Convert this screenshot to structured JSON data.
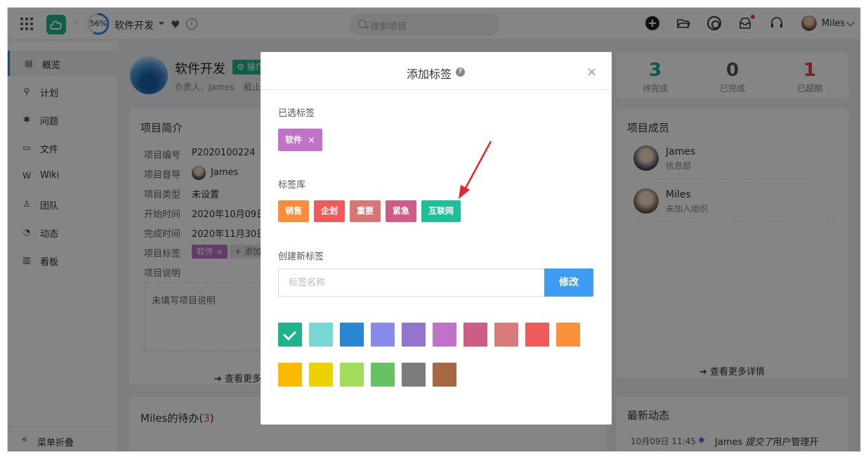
{
  "topbar": {
    "progress": "56%",
    "progress_value": 0.56,
    "project_name": "软件开发",
    "search_placeholder": "搜索项目",
    "user_name": "Miles"
  },
  "sidebar": {
    "items": [
      {
        "label": "概览",
        "icon": "overview-icon",
        "active": true
      },
      {
        "label": "计划",
        "icon": "plan-icon"
      },
      {
        "label": "问题",
        "icon": "bug-icon"
      },
      {
        "label": "文件",
        "icon": "folder-icon"
      },
      {
        "label": "Wiki",
        "icon": "wiki-icon"
      },
      {
        "label": "团队",
        "icon": "team-icon"
      },
      {
        "label": "动态",
        "icon": "activity-icon"
      },
      {
        "label": "看板",
        "icon": "board-icon"
      }
    ],
    "collapse_label": "菜单折叠"
  },
  "project": {
    "name": "软件开发",
    "op_label": "操作",
    "owner_line": "负责人：James",
    "owner_suffix": "截止",
    "intro_title": "项目简介",
    "fields": [
      {
        "label": "项目编号",
        "value": "P2020100224"
      },
      {
        "label": "项目督导",
        "value": "James"
      },
      {
        "label": "项目类型",
        "value": "未设置"
      },
      {
        "label": "开始时间",
        "value": "2020年10月09日"
      },
      {
        "label": "完成时间",
        "value": "2020年11月30日"
      },
      {
        "label": "项目标签",
        "value": ""
      },
      {
        "label": "项目说明",
        "value": ""
      }
    ],
    "tag_chip": "软件",
    "tag_add": "+ 添加",
    "description_placeholder": "未填写项目说明",
    "see_more": "查看更多"
  },
  "stats": [
    {
      "value": "3",
      "label": "待完成",
      "color": "#1fa68a"
    },
    {
      "value": "0",
      "label": "已完成",
      "color": "#555555"
    },
    {
      "value": "1",
      "label": "已超期",
      "color": "#e0433f"
    }
  ],
  "members": {
    "title": "项目成员",
    "list": [
      {
        "name": "James",
        "dept": "信息部"
      },
      {
        "name": "Miles",
        "dept": "未加入组织"
      }
    ],
    "see_more": "查看更多详情"
  },
  "todo": {
    "title_prefix": "Miles的待办(",
    "count": "3",
    "title_suffix": ")"
  },
  "activity": {
    "title": "最新动态",
    "entry_time": "10月09日 11:45",
    "entry_user": "James",
    "entry_action": "提交了",
    "entry_text": "用户管理开"
  },
  "modal": {
    "title": "添加标签",
    "selected_label": "已选标签",
    "selected_tags": [
      {
        "name": "软件",
        "color": "#c073c8"
      }
    ],
    "library_label": "标签库",
    "library_tags": [
      {
        "name": "销售",
        "color": "#fb8c3c"
      },
      {
        "name": "企划",
        "color": "#ef5b5b"
      },
      {
        "name": "重要",
        "color": "#d97575"
      },
      {
        "name": "紧急",
        "color": "#cf5c87"
      },
      {
        "name": "互联网",
        "color": "#1fbf9a"
      }
    ],
    "create_label": "创建新标签",
    "input_placeholder": "标签名称",
    "input_value": "",
    "button_label": "修改",
    "swatches": [
      "#1fb38a",
      "#79d7d4",
      "#2a86d1",
      "#8a8aec",
      "#9375cc",
      "#c073c8",
      "#cf5c87",
      "#d97b7b",
      "#ef5b5b",
      "#fb913c",
      "#fbb900",
      "#ecd300",
      "#a2dc5a",
      "#67c264",
      "#7b7b7b",
      "#a56842"
    ],
    "selected_swatch": 0
  }
}
